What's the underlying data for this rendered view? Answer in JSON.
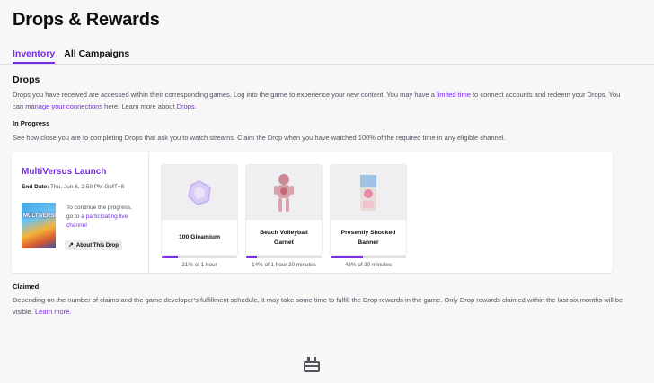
{
  "page": {
    "title": "Drops & Rewards"
  },
  "tabs": [
    {
      "label": "Inventory",
      "active": true
    },
    {
      "label": "All Campaigns",
      "active": false
    }
  ],
  "drops": {
    "title": "Drops",
    "intro": {
      "t1": "Drops you have received are accessed within their corresponding games. Log into the game to experience your new content. You may have a ",
      "link1": "limited time",
      "t2": " to connect accounts and redeem your Drops. You can ",
      "link2": "manage your connections",
      "t3": " here. Learn more about ",
      "link3": "Drops",
      "t4": "."
    }
  },
  "in_progress": {
    "title": "In Progress",
    "desc": "See how close you are to completing Drops that ask you to watch streams. Claim the Drop when you have watched 100% of the required time in any eligible channel."
  },
  "campaign": {
    "title": "MultiVersus Launch",
    "end_date_label": "End Date:",
    "end_date_value": " Thu, Jun 6, 2:59 PM GMT+8",
    "game_logo": "MULTIVERSUS",
    "continue_text": "To continue the progress, go to ",
    "continue_link": "a participating live channel",
    "about_button": "About This Drop",
    "rewards": [
      {
        "name": "100 Gleamium",
        "progress": 0.21,
        "label": "21% of 1 hour",
        "icon": "gleamium-icon"
      },
      {
        "name": "Beach Volleyball Garnet",
        "progress": 0.14,
        "label": "14% of 1 hour 30 minutes",
        "icon": "garnet-icon"
      },
      {
        "name": "Presently Shocked Banner",
        "progress": 0.43,
        "label": "43% of 30 minutes",
        "icon": "banner-icon"
      }
    ]
  },
  "claimed": {
    "title": "Claimed",
    "desc": "Depending on the number of claims and the game developer’s fulfillment schedule, it may take some time to fulfill the Drop rewards in the game. Only Drop rewards claimed within the last six months will be visible. ",
    "link": "Learn more."
  },
  "colors": {
    "accent": "#772ce8",
    "text_muted": "#53535f"
  }
}
